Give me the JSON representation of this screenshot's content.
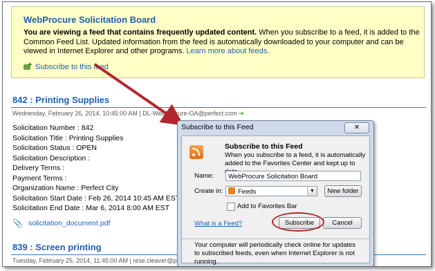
{
  "banner": {
    "title": "WebProcure Solicitation Board",
    "bold_text": "You are viewing a feed that contains frequently updated content.",
    "text": " When you subscribe to a feed, it is added to the Common Feed List. Updated information from the feed is automatically downloaded to your computer and can be viewed in Internet Explorer and other programs. ",
    "learn_more": "Learn more about feeds.",
    "subscribe_link": "Subscribe to this feed"
  },
  "entries": [
    {
      "title": "842 : Printing Supplies",
      "meta": "Wednesday, February 26, 2014, 10:45:00 AM | DL-WebProcure-OA@perfect.com",
      "details": [
        "Solicitation Number : 842",
        "Solicitation Title : Printing Supplies",
        "Solicitation Status : OPEN",
        "Solicitation Description :",
        "Delivery Terms :",
        "Payment Terms :",
        "Organization Name : Perfect City",
        "Solicitation Start Date : Feb 26, 2014 10:45 AM EST",
        "Solicitation End Date : Mar 6, 2014 8:00 AM EST"
      ],
      "attachment": "solicitation_document.pdf"
    },
    {
      "title": "839 : Screen printing",
      "meta": "Tuesday, February 25, 2014, 11:45:00 AM | rese.cleaver@perfect.com"
    }
  ],
  "dialog": {
    "window_title": "Subscribe to this Feed",
    "close_label": "✕",
    "heading": "Subscribe to this Feed",
    "description": "When you subscribe to a feed, it is automatically added to the Favorites Center and kept up to date.",
    "name_label": "Name:",
    "name_value": "WebProcure Solicitation Board",
    "create_in_label": "Create in:",
    "create_in_value": "Feeds",
    "new_folder_button": "New folder",
    "add_to_favorites_bar": "Add to Favorites Bar",
    "what_is_feed": "What is a Feed?",
    "subscribe_button": "Subscribe",
    "cancel_button": "Cancel",
    "footer": "Your computer will periodically check online for updates to subscribed feeds, even when Internet Explorer is not running."
  },
  "colors": {
    "link": "#1f5fb5",
    "banner_bg": "#ffffc6",
    "annotation": "#b3262c",
    "dialog_frame": "#cfdaea"
  }
}
